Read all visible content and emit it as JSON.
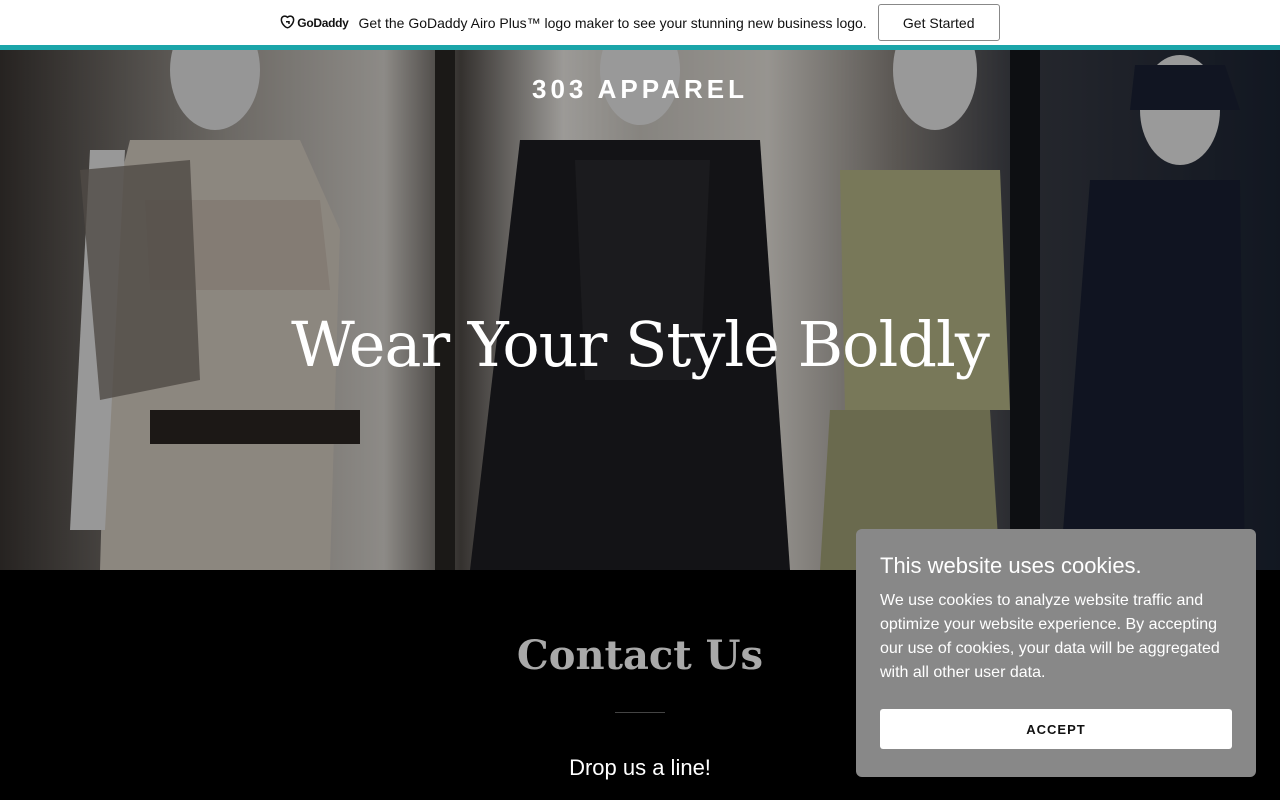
{
  "promo": {
    "logo_text": "GoDaddy",
    "message": "Get the GoDaddy Airo Plus™ logo maker to see your stunning new business logo.",
    "cta_label": "Get Started",
    "accent_color": "#1ba5a9"
  },
  "hero": {
    "brand": "303 APPAREL",
    "heading": "Wear Your Style Boldly"
  },
  "contact": {
    "title": "Contact Us",
    "subtitle": "Drop us a line!"
  },
  "cookie": {
    "title": "This website uses cookies.",
    "body": "We use cookies to analyze website traffic and optimize your website experience. By accepting our use of cookies, your data will be aggregated with all other user data.",
    "accept_label": "ACCEPT"
  }
}
